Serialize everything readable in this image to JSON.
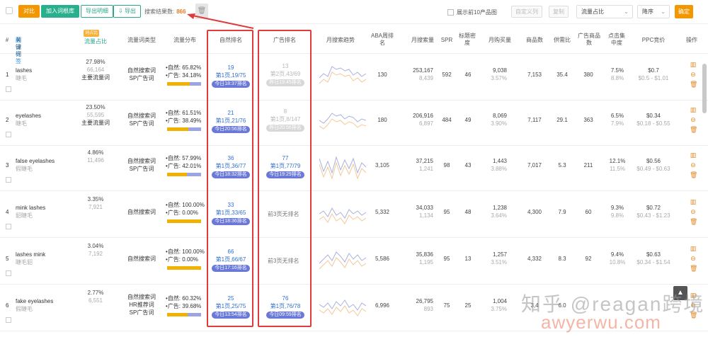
{
  "toolbar": {
    "compare": "对比",
    "add_to_root": "加入词根库",
    "export_long_tail": "导出明细",
    "export": "导出",
    "selected_label": "搜索结果数:",
    "selected_count": "866",
    "top10_label": "展示前10产品图",
    "btn_disabled_1": "自定义列",
    "btn_disabled_2": "复制",
    "sort_field": "流量占比",
    "sort_order": "降序",
    "confirm": "确定"
  },
  "headers": {
    "index": "#",
    "keyword": "关键词",
    "keyword_sub": "翻译标签",
    "traffic_tag": "词占比",
    "traffic": "流量占比",
    "type": "流量词类型",
    "dist": "流量分布",
    "organic_rank": "自然排名",
    "ad_rank": "广告排名",
    "trend": "月搜索趋势",
    "aba": "ABA周排名",
    "monthly_search": "月搜索量",
    "spr": "SPR",
    "title_density": "标题密度",
    "monthly_buy": "月购买量",
    "products": "商品数",
    "supply_demand": "供需比",
    "ad_products": "广告商品数",
    "click_conc": "点击集中度",
    "ppc": "PPC竞价",
    "ops": "操作"
  },
  "rows": [
    {
      "idx": "1",
      "kw": "lashes",
      "kw_cn": "睫毛",
      "traffic_pct": "27.98%",
      "traffic_num": "66,164",
      "traffic_type": "主要流量词",
      "types": [
        "自然搜索词",
        "SP广告词"
      ],
      "organic_pct": "65.82%",
      "ad_pct": "34.18%",
      "organic_share": 0.6582,
      "org_rank": "19",
      "org_page": "第1页,19/75",
      "org_today": "今日18:37排名",
      "ad_rank": "13",
      "ad_page": "第2页,43/69",
      "ad_today": "昨日19:45排名",
      "ad_gray": true,
      "aba": "130",
      "search": "253,167",
      "search_sub": "8,439",
      "spr": "592",
      "density": "46",
      "buy": "9,038",
      "buy_pct": "3.57%",
      "products": "7,153",
      "sd": "35.4",
      "ad_prod": "380",
      "click": "7.5%",
      "click_sub": "8.8%",
      "ppc": "$0.7",
      "ppc_range": "$0.5 - $1.01"
    },
    {
      "idx": "2",
      "kw": "eyelashes",
      "kw_cn": "睫毛",
      "traffic_pct": "23.50%",
      "traffic_num": "55,595",
      "traffic_type": "主要流量词",
      "types": [
        "自然搜索词",
        "SP广告词"
      ],
      "organic_pct": "61.51%",
      "ad_pct": "38.49%",
      "organic_share": 0.6151,
      "org_rank": "21",
      "org_page": "第1页,21/76",
      "org_today": "今日20:56排名",
      "ad_rank": "8",
      "ad_page": "第1页,8/147",
      "ad_today": "昨日20:56排名",
      "ad_gray": true,
      "aba": "180",
      "search": "206,916",
      "search_sub": "6,897",
      "spr": "484",
      "density": "49",
      "buy": "8,069",
      "buy_pct": "3.90%",
      "products": "7,117",
      "sd": "29.1",
      "ad_prod": "363",
      "click": "6.5%",
      "click_sub": "7.9%",
      "ppc": "$0.34",
      "ppc_range": "$0.18 - $0.55"
    },
    {
      "idx": "3",
      "kw": "false eyelashes",
      "kw_cn": "假睫毛",
      "traffic_pct": "4.86%",
      "traffic_num": "11,496",
      "traffic_type": "",
      "types": [
        "自然搜索词",
        "SP广告词"
      ],
      "organic_pct": "57.99%",
      "ad_pct": "42.01%",
      "organic_share": 0.5799,
      "org_rank": "36",
      "org_page": "第1页,36/77",
      "org_today": "今日18:32排名",
      "ad_rank": "77",
      "ad_page": "第1页,77/79",
      "ad_today": "今日19:29排名",
      "ad_gray": false,
      "aba": "3,105",
      "search": "37,215",
      "search_sub": "1,241",
      "spr": "98",
      "density": "43",
      "buy": "1,443",
      "buy_pct": "3.88%",
      "products": "7,017",
      "sd": "5.3",
      "ad_prod": "211",
      "click": "12.1%",
      "click_sub": "11.5%",
      "ppc": "$0.56",
      "ppc_range": "$0.49 - $0.63"
    },
    {
      "idx": "4",
      "kw": "mink lashes",
      "kw_cn": "貂睫毛",
      "traffic_pct": "3.35%",
      "traffic_num": "7,921",
      "traffic_type": "",
      "types": [
        "自然搜索词"
      ],
      "organic_pct": "100.00%",
      "ad_pct": "0.00%",
      "organic_share": 1.0,
      "org_rank": "33",
      "org_page": "第1页,33/65",
      "org_today": "今日18:36排名",
      "ad_rank": "",
      "ad_page": "",
      "ad_today": "",
      "ad_none": "前3页无排名",
      "ad_gray": false,
      "aba": "5,332",
      "search": "34,033",
      "search_sub": "1,134",
      "spr": "95",
      "density": "48",
      "buy": "1,238",
      "buy_pct": "3.64%",
      "products": "4,300",
      "sd": "7.9",
      "ad_prod": "60",
      "click": "9.3%",
      "click_sub": "9.8%",
      "ppc": "$0.72",
      "ppc_range": "$0.43 - $1.23"
    },
    {
      "idx": "5",
      "kw": "lashes mink",
      "kw_cn": "睫毛貂",
      "traffic_pct": "3.04%",
      "traffic_num": "7,192",
      "traffic_type": "",
      "types": [
        "自然搜索词"
      ],
      "organic_pct": "100.00%",
      "ad_pct": "0.00%",
      "organic_share": 1.0,
      "org_rank": "66",
      "org_page": "第1页,66/67",
      "org_today": "今日17:16排名",
      "ad_rank": "",
      "ad_page": "",
      "ad_today": "",
      "ad_none": "前3页无排名",
      "ad_gray": false,
      "aba": "5,586",
      "search": "35,836",
      "search_sub": "1,195",
      "spr": "95",
      "density": "13",
      "buy": "1,257",
      "buy_pct": "3.51%",
      "products": "4,332",
      "sd": "8.3",
      "ad_prod": "92",
      "click": "9.4%",
      "click_sub": "10.8%",
      "ppc": "$0.63",
      "ppc_range": "$0.34 - $1.54"
    },
    {
      "idx": "6",
      "kw": "fake eyelashes",
      "kw_cn": "假睫毛",
      "traffic_pct": "2.77%",
      "traffic_num": "6,551",
      "traffic_type": "",
      "types": [
        "自然搜索词",
        "HR推荐词",
        "SP广告词"
      ],
      "organic_pct": "60.32%",
      "ad_pct": "39.68%",
      "organic_share": 0.6032,
      "org_rank": "25",
      "org_page": "第1页,25/75",
      "org_today": "今日13:54排名",
      "ad_rank": "76",
      "ad_page": "第1页,76/78",
      "ad_today": "今日09:59排名",
      "ad_gray": false,
      "aba": "6,996",
      "search": "26,795",
      "search_sub": "893",
      "spr": "75",
      "density": "25",
      "buy": "1,004",
      "buy_pct": "3.75%",
      "products": "3,4",
      "sd": "6.0",
      "ad_prod": "",
      "click": "",
      "click_sub": "",
      "ppc": "",
      "ppc_range": ""
    }
  ],
  "dist_labels": {
    "organic": "自然:",
    "ad": "广告:"
  },
  "watermark": "知乎 @reagan跨境",
  "watermark2": "awyerwu.com",
  "colors": {
    "organic_bar": "#f0b100",
    "ad_bar": "#9da4e6",
    "pill": "#6a78d8",
    "accent": "#28b08e",
    "orange": "#f39700",
    "highlight_box": "#e03b3b"
  }
}
